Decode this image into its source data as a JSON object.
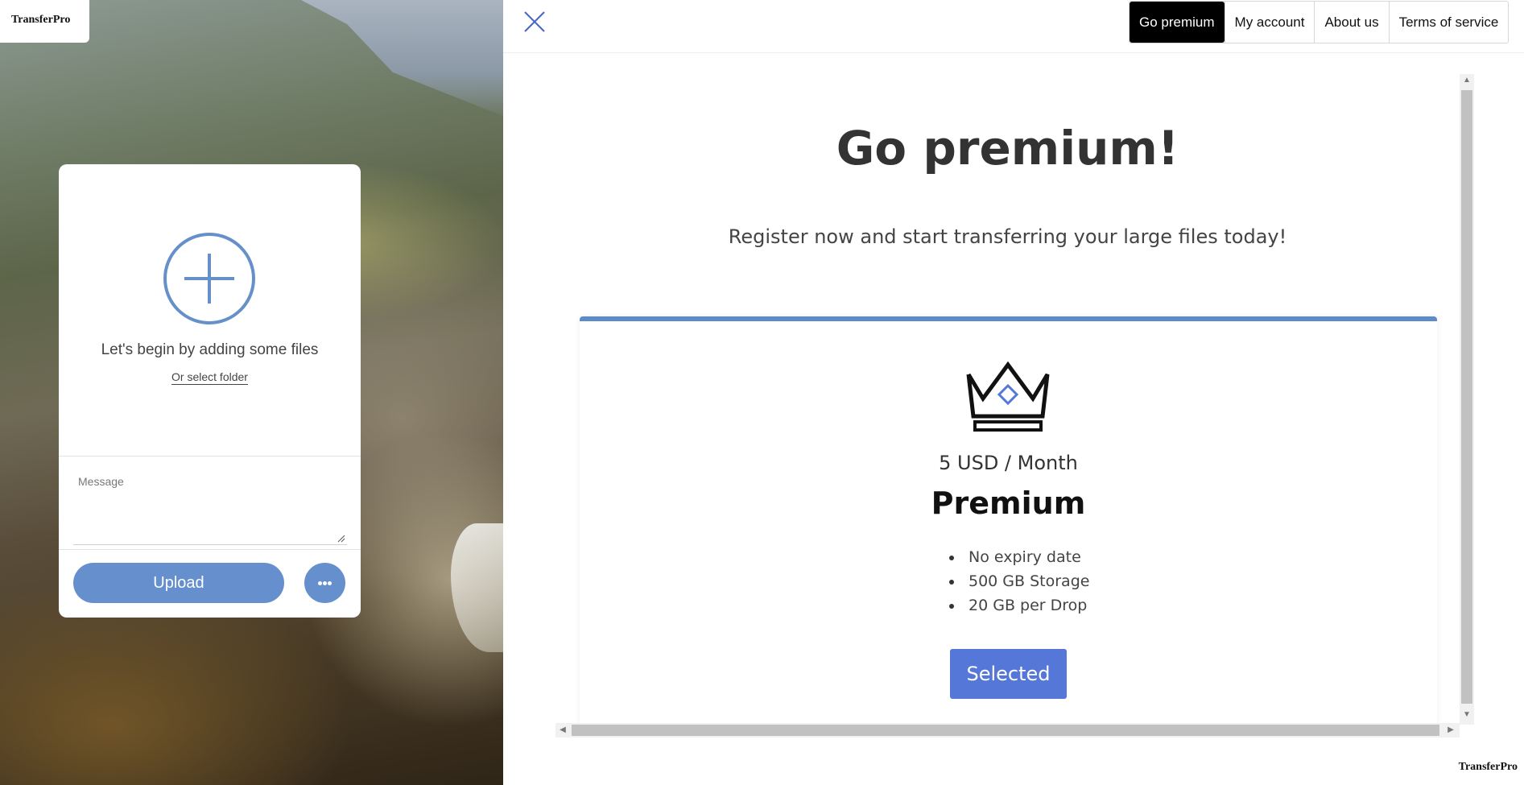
{
  "app": {
    "logo": "TransferPro",
    "footer_logo": "TransferPro"
  },
  "nav": {
    "items": [
      {
        "label": "Go premium",
        "active": true
      },
      {
        "label": "My account",
        "active": false
      },
      {
        "label": "About us",
        "active": false
      },
      {
        "label": "Terms of service",
        "active": false
      }
    ]
  },
  "upload": {
    "add_files_text": "Let's begin by adding some files",
    "select_folder_link": "Or select folder",
    "message_placeholder": "Message",
    "upload_button": "Upload",
    "more_icon": "more-dots-icon",
    "add_icon": "plus-circle-icon"
  },
  "premium": {
    "title": "Go premium!",
    "subtitle": "Register now and start transferring your large files today!",
    "plan": {
      "icon": "crown-icon",
      "price": "5 USD / Month",
      "name": "Premium",
      "features": [
        "No expiry date",
        "500 GB Storage",
        "20 GB per Drop"
      ],
      "button": "Selected"
    }
  },
  "colors": {
    "accent": "#6690cd",
    "selected_button": "#5578d8",
    "card_top_border": "#5d8ac9",
    "nav_active_bg": "#000000"
  }
}
